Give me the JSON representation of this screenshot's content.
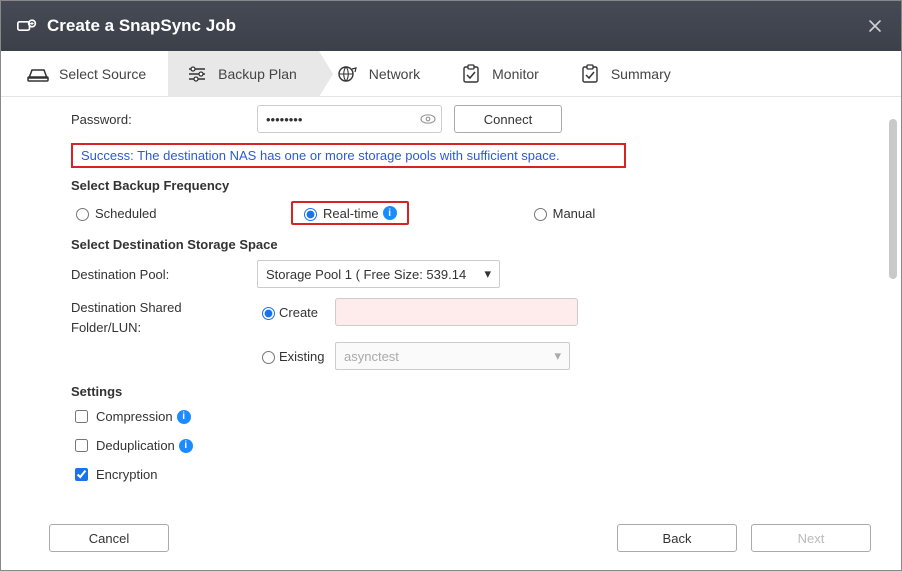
{
  "title": "Create a SnapSync Job",
  "steps": [
    {
      "label": "Select Source"
    },
    {
      "label": "Backup Plan"
    },
    {
      "label": "Network"
    },
    {
      "label": "Monitor"
    },
    {
      "label": "Summary"
    }
  ],
  "password": {
    "label": "Password:",
    "value": "••••••••"
  },
  "connect_label": "Connect",
  "success_msg": "Success: The destination NAS has one or more storage pools with sufficient space.",
  "backup_freq_head": "Select Backup Frequency",
  "freq": {
    "scheduled": "Scheduled",
    "realtime": "Real-time",
    "manual": "Manual"
  },
  "dest_space_head": "Select Destination Storage Space",
  "dest_pool": {
    "label": "Destination Pool:",
    "value": "Storage Pool 1 ( Free Size: 539.14"
  },
  "dest_shared": {
    "label_l1": "Destination Shared",
    "label_l2": "Folder/LUN:"
  },
  "dest_opts": {
    "create": "Create",
    "existing": "Existing",
    "existing_value": "asynctest"
  },
  "settings_head": "Settings",
  "settings": {
    "compression": "Compression",
    "dedup": "Deduplication",
    "encryption": "Encryption"
  },
  "buttons": {
    "cancel": "Cancel",
    "back": "Back",
    "next": "Next"
  }
}
